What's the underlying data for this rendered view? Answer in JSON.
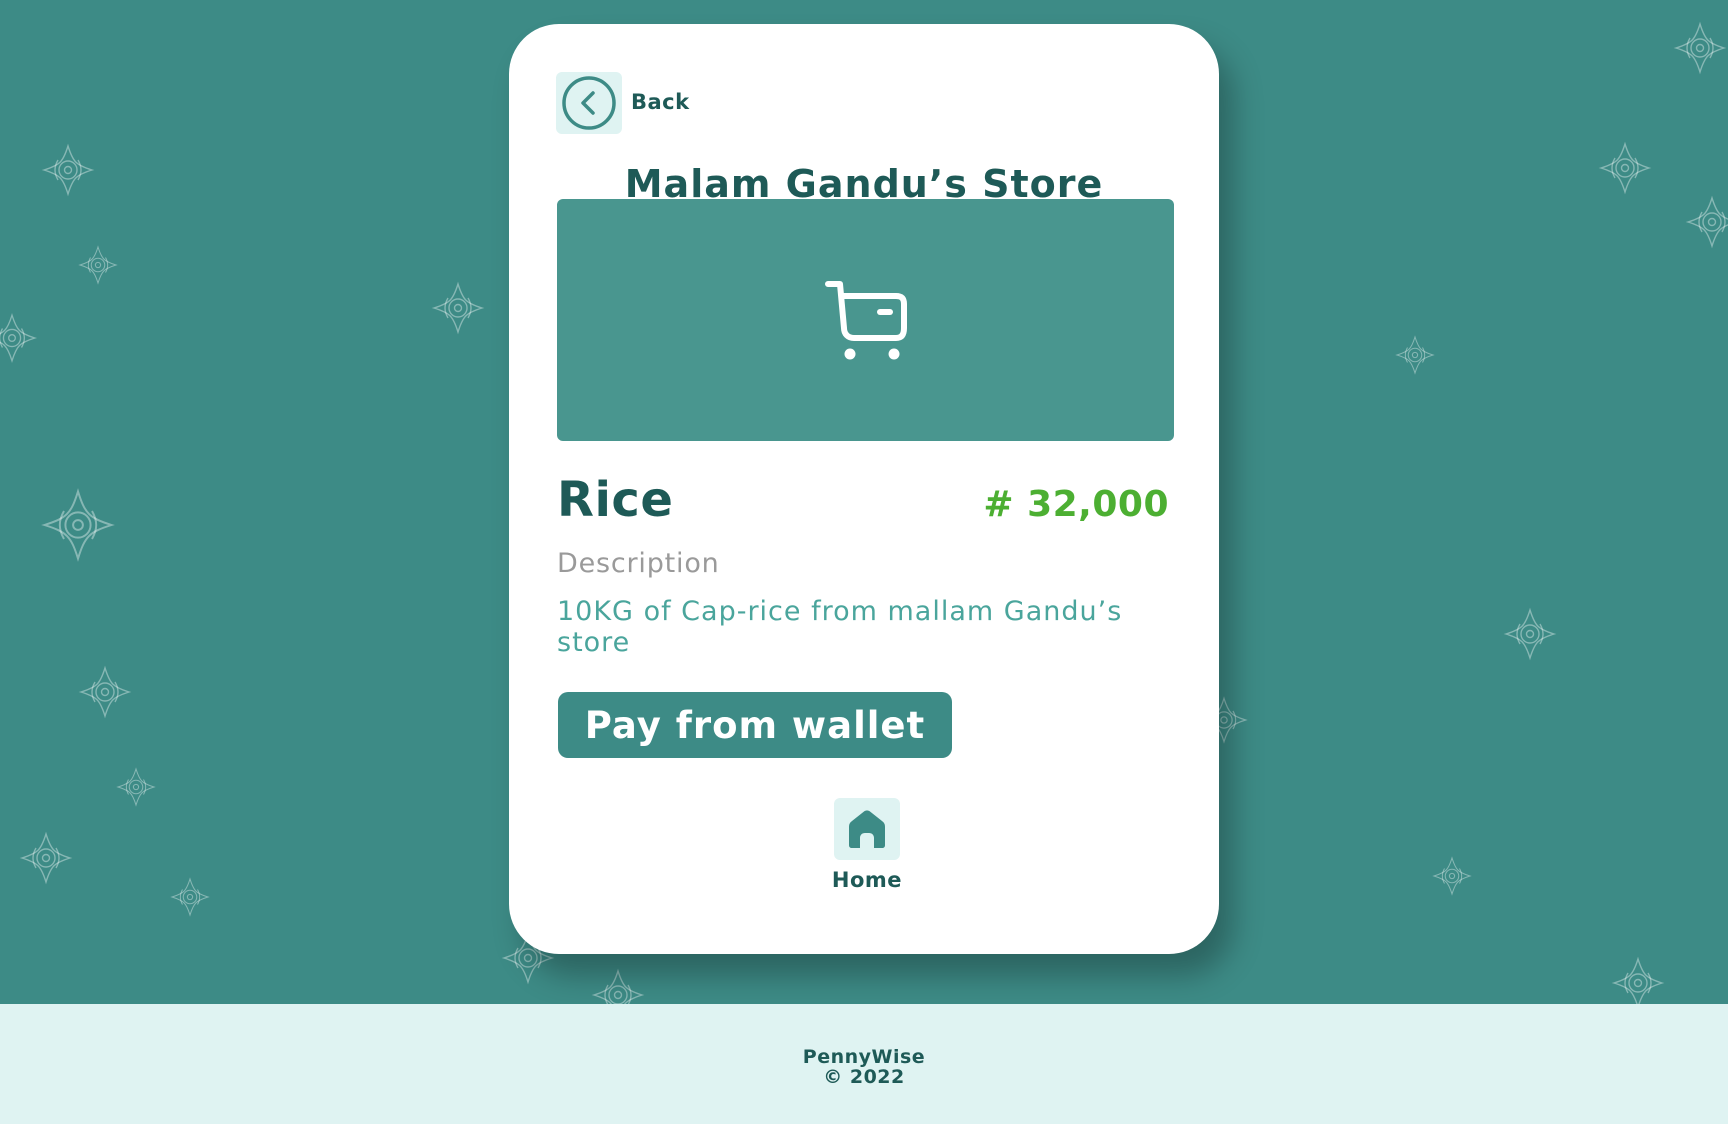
{
  "header": {
    "back_label": "Back",
    "back_icon": "chevron-left-circle-icon",
    "store_title": "Malam Gandu’s Store"
  },
  "product": {
    "image_icon": "shopping-cart-icon",
    "name": "Rice",
    "price": "# 32,000",
    "description_label": "Description",
    "description": "10KG of Cap-rice from mallam Gandu’s store"
  },
  "actions": {
    "pay_label": "Pay from wallet"
  },
  "nav": {
    "home_label": "Home",
    "home_icon": "home-icon"
  },
  "footer": {
    "brand": "PennyWise",
    "copyright": "© 2022"
  },
  "colors": {
    "background": "#3d8b86",
    "primary_dark": "#1e5a57",
    "price_green": "#4caf32",
    "accent_teal": "#4aa59c",
    "light_tint": "#dff3f2"
  }
}
